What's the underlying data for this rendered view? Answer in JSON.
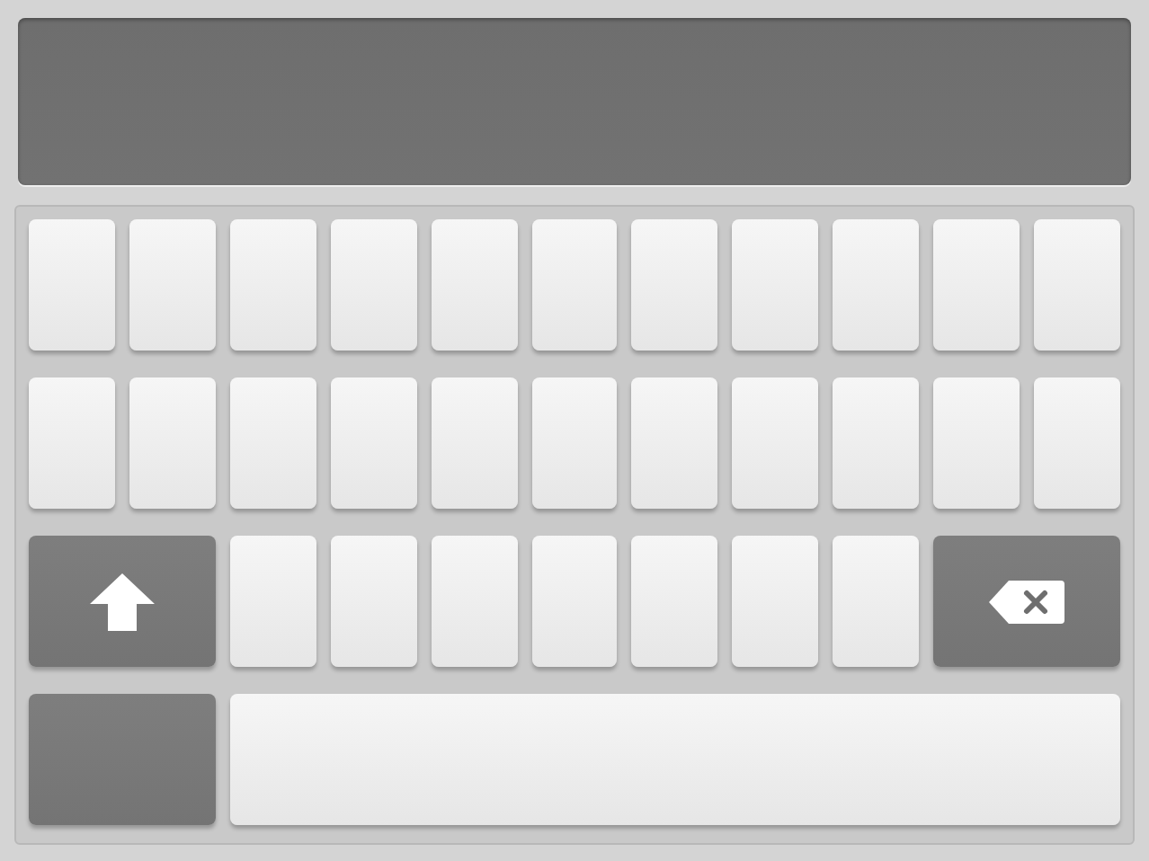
{
  "display": {
    "kind": "text-display"
  },
  "rows": [
    {
      "keys": [
        {
          "kind": "letter"
        },
        {
          "kind": "letter"
        },
        {
          "kind": "letter"
        },
        {
          "kind": "letter"
        },
        {
          "kind": "letter"
        },
        {
          "kind": "letter"
        },
        {
          "kind": "letter"
        },
        {
          "kind": "letter"
        },
        {
          "kind": "letter"
        },
        {
          "kind": "letter"
        },
        {
          "kind": "letter"
        }
      ]
    },
    {
      "keys": [
        {
          "kind": "letter"
        },
        {
          "kind": "letter"
        },
        {
          "kind": "letter"
        },
        {
          "kind": "letter"
        },
        {
          "kind": "letter"
        },
        {
          "kind": "letter"
        },
        {
          "kind": "letter"
        },
        {
          "kind": "letter"
        },
        {
          "kind": "letter"
        },
        {
          "kind": "letter"
        },
        {
          "kind": "letter"
        }
      ]
    },
    {
      "keys": [
        {
          "kind": "shift"
        },
        {
          "kind": "letter"
        },
        {
          "kind": "letter"
        },
        {
          "kind": "letter"
        },
        {
          "kind": "letter"
        },
        {
          "kind": "letter"
        },
        {
          "kind": "letter"
        },
        {
          "kind": "letter"
        },
        {
          "kind": "backspace"
        }
      ]
    },
    {
      "keys": [
        {
          "kind": "function"
        },
        {
          "kind": "space"
        }
      ]
    }
  ]
}
